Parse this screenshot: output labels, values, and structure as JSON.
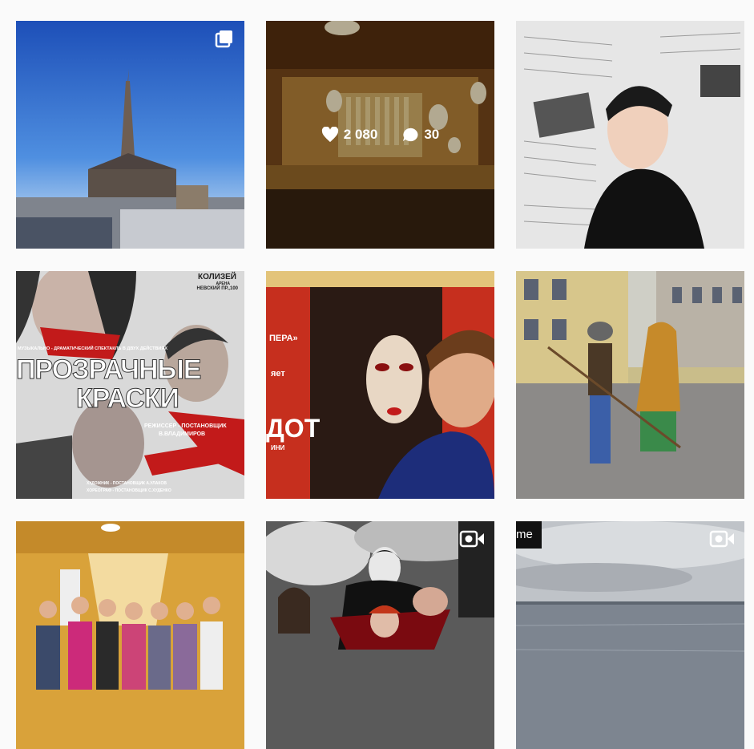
{
  "grid": {
    "posts": [
      {
        "name": "vienna-cathedral",
        "type": "gallery",
        "badge": "gallery-icon"
      },
      {
        "name": "concert-hall",
        "type": "image",
        "hover": true,
        "likes": "2 080",
        "comments": "30"
      },
      {
        "name": "newspaper-portrait",
        "type": "image"
      },
      {
        "name": "poster-prozrachnye-kraski",
        "type": "image",
        "poster": {
          "arena": "КОЛИЗЕЙ",
          "arena_sub": "АРЕНА",
          "address": "НЕВСКИЙ ПР.,100",
          "tag": "МУЗЫКАЛЬНО - ДРАМАТИЧЕСКИЙ СПЕКТАКЛЬ В ДВУХ ДЕЙСТВИЯХ",
          "title1": "ПРОЗРАЧНЫЕ",
          "title2": "КРАСКИ",
          "director_label": "РЕЖИССЕР - ПОСТАНОВЩИК",
          "director": "В.ВЛАДИМИРОВ",
          "credit1": "ХУДОЖНИК - ПОСТАНОВЩИК А.УЛАКОВ",
          "credit2": "ХОРЕОГРАФ - ПОСТАНОВЩИК С.ХУДЕНКО"
        }
      },
      {
        "name": "selfie-mask-poster",
        "type": "image",
        "sign": {
          "line1": "ПЕРА»",
          "line2": "яет",
          "big": "ДОТ",
          "line3": "ИНИ"
        }
      },
      {
        "name": "street-costume",
        "type": "image"
      },
      {
        "name": "group-hallway",
        "type": "image"
      },
      {
        "name": "vampire-video",
        "type": "video",
        "badge": "video-icon"
      },
      {
        "name": "sea-video",
        "type": "video",
        "badge": "video-icon",
        "corner_text": "me"
      }
    ]
  },
  "colors": {
    "background": "#fafafa",
    "overlay_text": "#ffffff"
  }
}
